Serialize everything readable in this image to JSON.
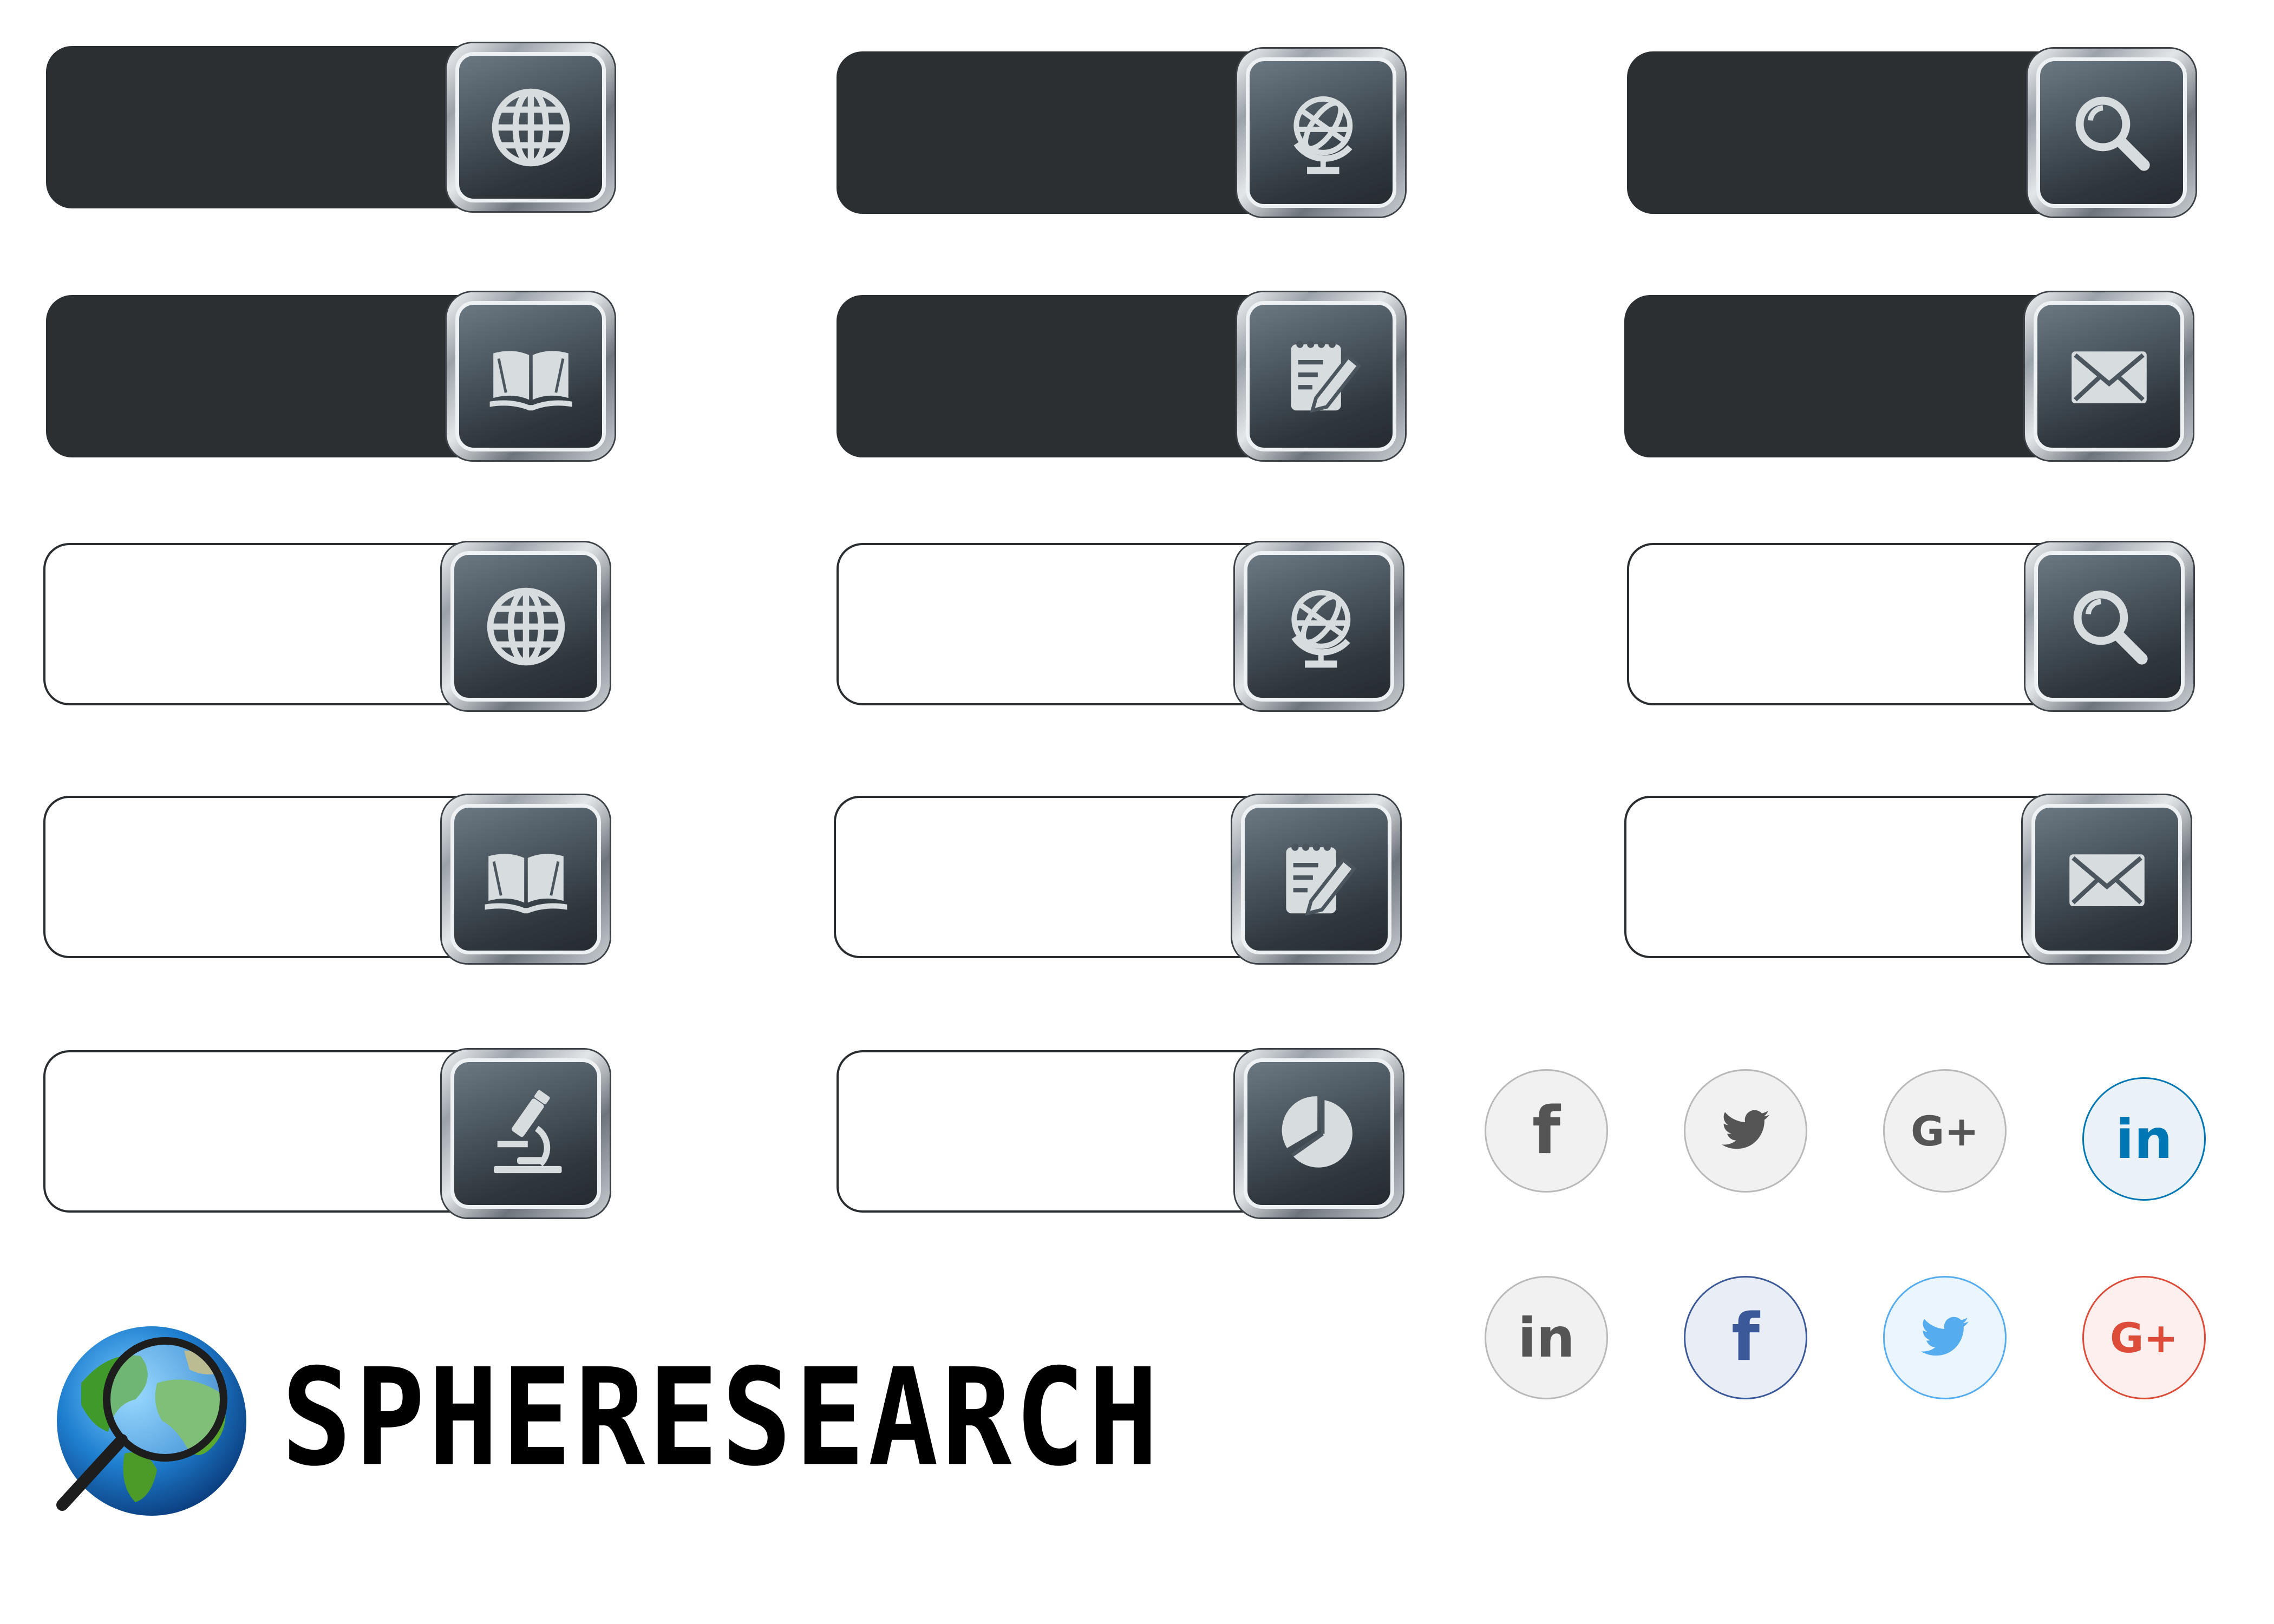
{
  "brand": {
    "name": "SPHERESEARCH"
  },
  "colors": {
    "bar_dark": "#2c2f32",
    "icon_face": "#3b444b",
    "icon_glyph": "#d7dcdf",
    "social_gray": "#555555",
    "facebook": "#3b5998",
    "twitter": "#55acee",
    "googleplus": "#dd4b39",
    "linkedin": "#0077b5"
  },
  "search_bars": [
    {
      "style": "dark",
      "icon": "globe-icon"
    },
    {
      "style": "dark",
      "icon": "desk-globe-icon"
    },
    {
      "style": "dark",
      "icon": "magnifier-icon"
    },
    {
      "style": "dark",
      "icon": "book-icon"
    },
    {
      "style": "dark",
      "icon": "notepad-pencil-icon"
    },
    {
      "style": "dark",
      "icon": "envelope-icon"
    },
    {
      "style": "light",
      "icon": "globe-icon"
    },
    {
      "style": "light",
      "icon": "desk-globe-icon"
    },
    {
      "style": "light",
      "icon": "magnifier-icon"
    },
    {
      "style": "light",
      "icon": "book-icon"
    },
    {
      "style": "light",
      "icon": "notepad-pencil-icon"
    },
    {
      "style": "light",
      "icon": "envelope-icon"
    },
    {
      "style": "light",
      "icon": "microscope-icon"
    },
    {
      "style": "light",
      "icon": "pie-chart-icon"
    }
  ],
  "social_buttons": [
    {
      "network": "facebook",
      "glyph": "f",
      "variant": "gray"
    },
    {
      "network": "twitter",
      "glyph": "",
      "variant": "gray"
    },
    {
      "network": "googleplus",
      "glyph": "G+",
      "variant": "gray"
    },
    {
      "network": "linkedin",
      "glyph": "in",
      "variant": "color"
    },
    {
      "network": "linkedin",
      "glyph": "in",
      "variant": "gray"
    },
    {
      "network": "facebook",
      "glyph": "f",
      "variant": "color"
    },
    {
      "network": "twitter",
      "glyph": "",
      "variant": "color"
    },
    {
      "network": "googleplus",
      "glyph": "G+",
      "variant": "color"
    }
  ]
}
